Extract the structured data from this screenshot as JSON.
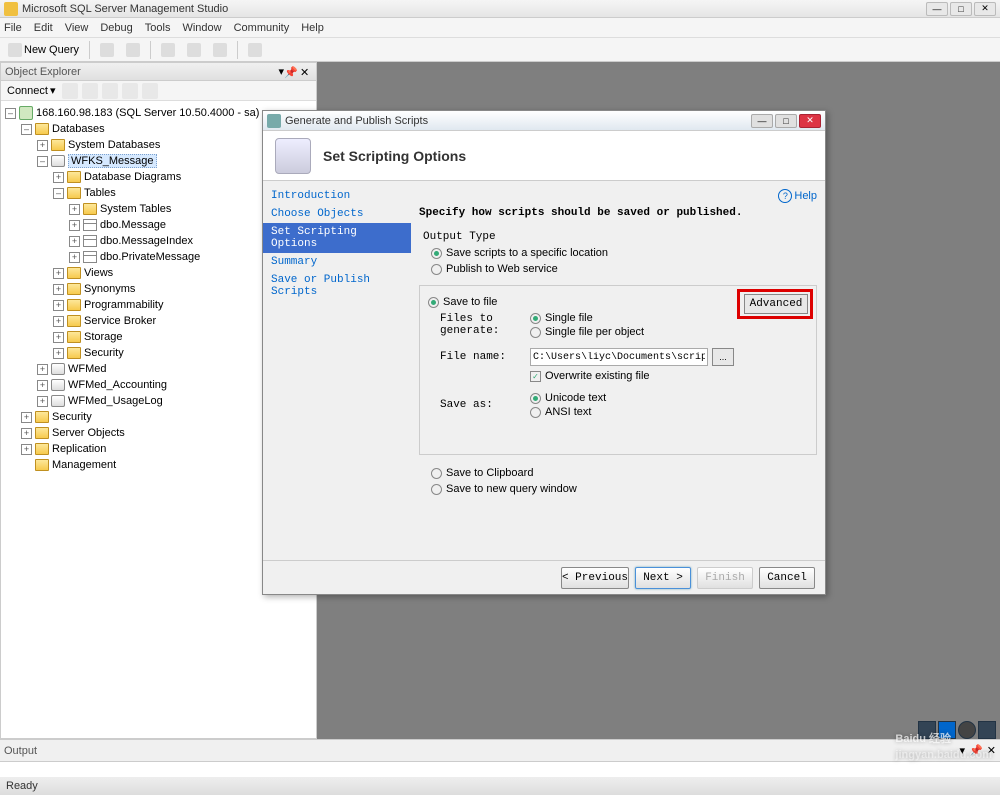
{
  "app": {
    "title": "Microsoft SQL Server Management Studio",
    "menu": [
      "File",
      "Edit",
      "View",
      "Debug",
      "Tools",
      "Window",
      "Community",
      "Help"
    ],
    "newQuery": "New Query"
  },
  "objectExplorer": {
    "title": "Object Explorer",
    "connect": "Connect",
    "tree": {
      "server": "168.160.98.183 (SQL Server 10.50.4000 - sa)",
      "databases": "Databases",
      "systemDatabases": "System Databases",
      "wfks": "WFKS_Message",
      "diagrams": "Database Diagrams",
      "tables": "Tables",
      "systemTables": "System Tables",
      "dboMessage": "dbo.Message",
      "dboMessageIndex": "dbo.MessageIndex",
      "dboPrivateMessage": "dbo.PrivateMessage",
      "views": "Views",
      "synonyms": "Synonyms",
      "programmability": "Programmability",
      "serviceBroker": "Service Broker",
      "storage": "Storage",
      "security": "Security",
      "wfmed": "WFMed",
      "wfmedAcc": "WFMed_Accounting",
      "wfmedUsage": "WFMed_UsageLog",
      "securityTop": "Security",
      "serverObjects": "Server Objects",
      "replication": "Replication",
      "management": "Management"
    }
  },
  "dialog": {
    "title": "Generate and Publish Scripts",
    "heading": "Set Scripting Options",
    "nav": {
      "intro": "Introduction",
      "choose": "Choose Objects",
      "setOpts": "Set Scripting Options",
      "summary": "Summary",
      "savePublish": "Save or Publish Scripts"
    },
    "helpLabel": "Help",
    "sectionTitle": "Specify how scripts should be saved or published.",
    "outputType": {
      "label": "Output Type",
      "saveLocation": "Save scripts to a specific location",
      "publishWeb": "Publish to Web service"
    },
    "saveToFile": {
      "label": "Save to file",
      "advanced": "Advanced",
      "filesToGenerate": "Files to generate:",
      "singleFile": "Single file",
      "singleFilePerObject": "Single file per object",
      "fileName": "File name:",
      "fileNameValue": "C:\\Users\\liyc\\Documents\\script.sql",
      "browse": "...",
      "overwrite": "Overwrite existing file",
      "saveAs": "Save as:",
      "unicode": "Unicode text",
      "ansi": "ANSI text"
    },
    "saveToClipboard": "Save to Clipboard",
    "saveToNewQuery": "Save to new query window",
    "buttons": {
      "previous": "< Previous",
      "next": "Next >",
      "finish": "Finish",
      "cancel": "Cancel"
    }
  },
  "output": {
    "title": "Output"
  },
  "status": {
    "ready": "Ready"
  },
  "watermark": {
    "main": "Baidu 经验",
    "sub": "jingyan.baidu.com"
  }
}
